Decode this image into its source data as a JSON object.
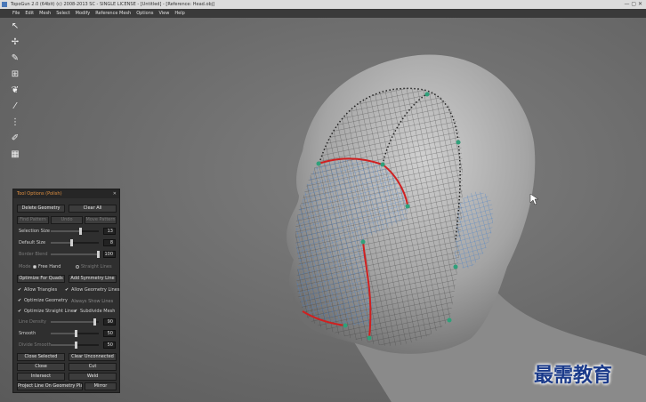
{
  "window": {
    "title": "TopoGun 2.0 (64bit) (c) 2008-2013 SC - SINGLE LICENSE - [Untitled] - [Reference: Head.obj]"
  },
  "menu": [
    "File",
    "Edit",
    "Mesh",
    "Select",
    "Modify",
    "Reference Mesh",
    "Options",
    "View",
    "Help"
  ],
  "toolbar": {
    "tools": [
      "select-tool-icon",
      "simple-create-tool-icon",
      "draw-tool-icon",
      "bridge-tool-icon",
      "brush-tool-icon",
      "knife-tool-icon",
      "tubes-tool-icon",
      "pen-tool-icon",
      "grid-tool-icon"
    ]
  },
  "panel": {
    "title": "Tool Options (Polish)",
    "delete_geometry": "Delete Geometry",
    "clear_all": "Clear All",
    "find_pattern": "Find Pattern",
    "undo": "Undo",
    "move_pattern": "Move Pattern",
    "selection_size": {
      "label": "Selection Size",
      "value": "13",
      "level": 0.6
    },
    "default_size": {
      "label": "Default Size",
      "value": "8",
      "level": 0.4
    },
    "border_blend": {
      "label": "Border Blend",
      "value": "100",
      "level": 1.0
    },
    "mode_label": "Mode",
    "mode_free": "Free Hand",
    "mode_straight": "Straight Lines",
    "optimize_for_quads": "Optimize For Quads",
    "add_symmetry_line": "Add Symmetry Line",
    "checks": [
      {
        "label": "Allow Triangles",
        "checked": true
      },
      {
        "label": "Allow Geometry Lines",
        "checked": true
      },
      {
        "label": "Optimize Geometry",
        "checked": true
      },
      {
        "label": "Always Show Lines",
        "checked": false
      },
      {
        "label": "Optimize Straight Lines",
        "checked": true
      },
      {
        "label": "Subdivide Mesh",
        "checked": true
      }
    ],
    "line_density": {
      "label": "Line Density",
      "value": "90",
      "level": 0.9
    },
    "smooth": {
      "label": "Smooth",
      "value": "50",
      "level": 0.5
    },
    "divide_smooth": {
      "label": "Divide Smooth",
      "value": "50",
      "level": 0.5
    },
    "close_selected": "Close Selected",
    "clear_unconnected": "Clear Unconnected",
    "close": "Close",
    "cut": "Cut",
    "intersect": "Intersect",
    "weld": "Weld",
    "project_line": "Project Line On Geometry Plane",
    "mirror": "Mirror"
  },
  "watermark": "最需教育",
  "colors": {
    "accent_orange": "#e09040",
    "wire_blue": "#4a82c8",
    "border_red": "#d02020",
    "vertex_green": "#2fa07a"
  }
}
